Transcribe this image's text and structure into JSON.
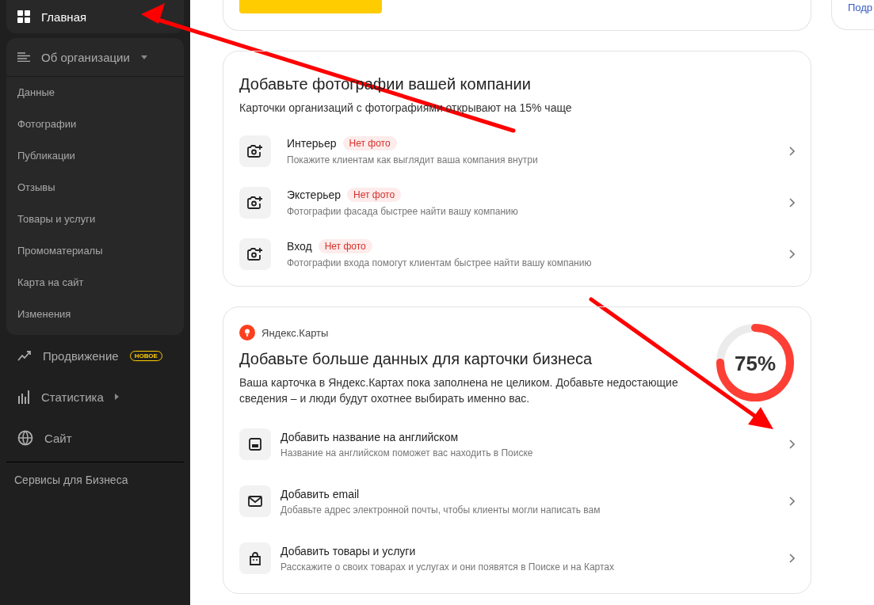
{
  "sidebar": {
    "home": {
      "label": "Главная",
      "selected": true
    },
    "section": {
      "label": "Об организации",
      "expanded": true,
      "items": [
        {
          "label": "Данные"
        },
        {
          "label": "Фотографии"
        },
        {
          "label": "Публикации"
        },
        {
          "label": "Отзывы"
        },
        {
          "label": "Товары и услуги"
        },
        {
          "label": "Промоматериалы"
        },
        {
          "label": "Карта на сайт"
        },
        {
          "label": "Изменения"
        }
      ]
    },
    "nav": [
      {
        "label": "Продвижение",
        "kind": "link",
        "badge": "НОВОЕ"
      },
      {
        "label": "Статистика",
        "kind": "submenu"
      },
      {
        "label": "Сайт",
        "kind": "link"
      }
    ],
    "footer": "Сервисы для Бизнеса"
  },
  "right_card": {
    "link": "Подр"
  },
  "photos_card": {
    "title": "Добавьте фотографии вашей компании",
    "subtitle": "Карточки организаций с фотографиями открывают на 15% чаще",
    "items": [
      {
        "title": "Интерьер",
        "badge": "Нет фото",
        "description": "Покажите клиентам как выглядит ваша компания внутри"
      },
      {
        "title": "Экстерьер",
        "badge": "Нет фото",
        "description": "Фотографии фасада быстрее найти вашу компанию"
      },
      {
        "title": "Вход",
        "badge": "Нет фото",
        "description": "Фотографии входа помогут клиентам быстрее найти вашу компанию"
      }
    ]
  },
  "maps_card": {
    "brand": "Яндекс.Карты",
    "title": "Добавьте больше данных для карточки бизнеса",
    "description": "Ваша карточка в Яндекс.Картах пока заполнена не целиком. Добавьте недостающие сведения – и люди будут охотнее выбирать именно вас.",
    "progress": {
      "reading": "75%"
    },
    "items": [
      {
        "kind": "name",
        "title": "Добавить название на английском",
        "description": "Название на английском поможет вас находить в Поиске"
      },
      {
        "kind": "email",
        "title": "Добавить email",
        "description": "Добавьте адрес электронной почты, чтобы клиенты могли написать вам"
      },
      {
        "kind": "goods",
        "title": "Добавить товары и услуги",
        "description": "Расскажите о своих товарах и услугах и они появятся в Поиске и на Картах"
      }
    ]
  }
}
